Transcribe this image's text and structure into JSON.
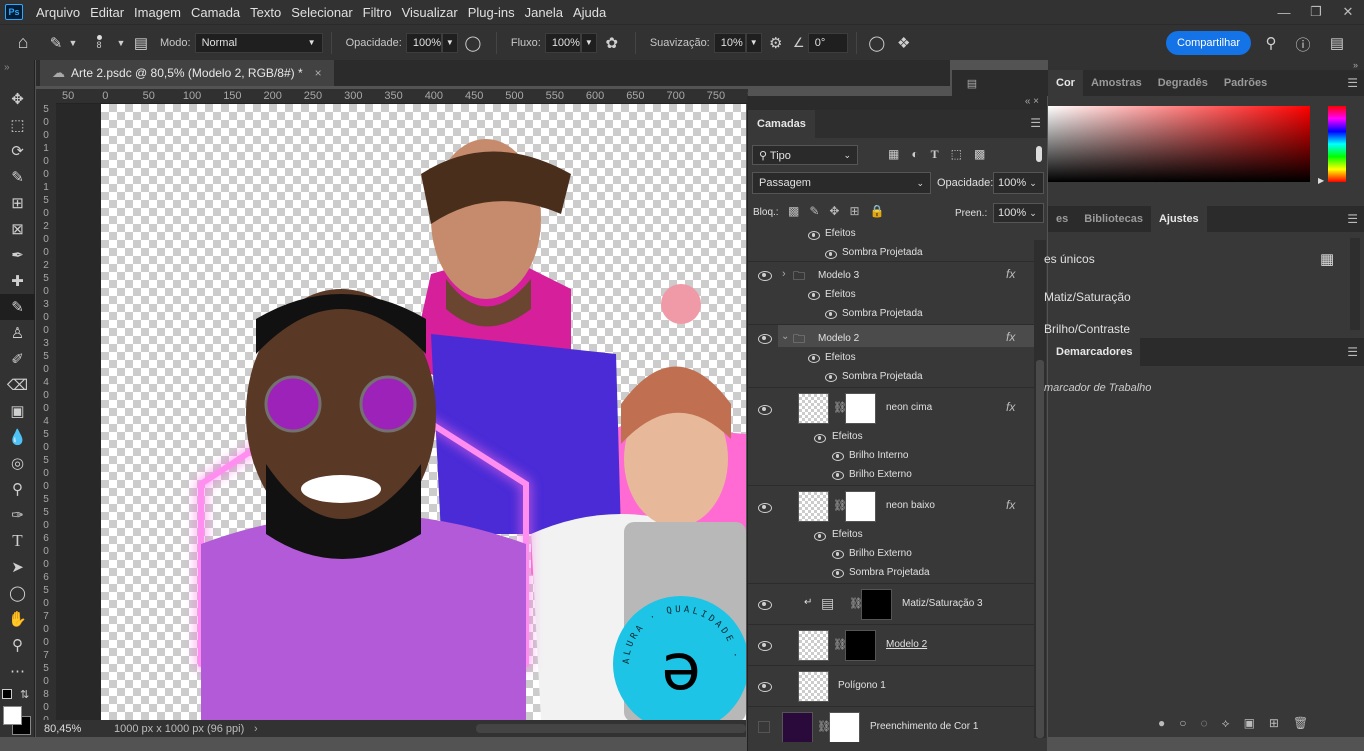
{
  "menu": [
    "Arquivo",
    "Editar",
    "Imagem",
    "Camada",
    "Texto",
    "Selecionar",
    "Filtro",
    "Visualizar",
    "Plug-ins",
    "Janela",
    "Ajuda"
  ],
  "app_logo": "Ps",
  "options": {
    "brush_size": "8",
    "mode_label": "Modo:",
    "mode_value": "Normal",
    "opacity_label": "Opacidade:",
    "opacity_value": "100%",
    "flow_label": "Fluxo:",
    "flow_value": "100%",
    "smoothing_label": "Suavização:",
    "smoothing_value": "10%",
    "angle_value": "0°",
    "share_label": "Compartilhar"
  },
  "document": {
    "tab_title": "Arte 2.psdc @ 80,5% (Modelo 2, RGB/8#) *",
    "zoom": "80,45%",
    "doc_info": "1000 px x 1000 px (96 ppi)"
  },
  "ruler_top": [
    "50",
    "0",
    "50",
    "100",
    "150",
    "200",
    "250",
    "300",
    "350",
    "400",
    "450",
    "500",
    "550",
    "600",
    "650",
    "700",
    "750",
    "800",
    "850"
  ],
  "ruler_left": [
    "5",
    "0",
    "0",
    "1",
    "0",
    "0",
    "1",
    "5",
    "0",
    "2",
    "0",
    "0",
    "2",
    "5",
    "0",
    "3",
    "0",
    "0",
    "3",
    "5",
    "0",
    "4",
    "0",
    "0",
    "4",
    "5",
    "0",
    "5",
    "0",
    "0",
    "5",
    "5",
    "0",
    "6",
    "0",
    "0",
    "6",
    "5",
    "0",
    "7",
    "0",
    "0",
    "7",
    "5",
    "0",
    "8",
    "0",
    "0",
    "8",
    "5",
    "0"
  ],
  "layers": {
    "tab": "Camadas",
    "filter_kind": "Tipo",
    "blend_mode": "Passagem",
    "opacity_label": "Opacidade:",
    "opacity_value": "100%",
    "lock_label": "Bloq.:",
    "fill_label": "Preen.:",
    "fill_value": "100%",
    "rows": {
      "r0_effects": "Efeitos",
      "r0_shadow": "Sombra Projetada",
      "modelo3": "Modelo 3",
      "m3_effects": "Efeitos",
      "m3_shadow": "Sombra Projetada",
      "modelo2": "Modelo 2",
      "m2_effects": "Efeitos",
      "m2_shadow": "Sombra Projetada",
      "neon_cima": "neon cima",
      "nc_effects": "Efeitos",
      "nc_inner": "Brilho Interno",
      "nc_outer": "Brilho Externo",
      "neon_baixo": "neon baixo",
      "nb_effects": "Efeitos",
      "nb_outer": "Brilho Externo",
      "nb_shadow": "Sombra Projetada",
      "matiz": "Matiz/Saturação 3",
      "modelo2_layer": "Modelo 2",
      "poligono": "Polígono 1",
      "preenchimento": "Preenchimento de Cor 1"
    },
    "fx": "fx"
  },
  "right": {
    "color_tabs": [
      "Cor",
      "Amostras",
      "Degradês",
      "Padrões"
    ],
    "adj_tabs": [
      "es",
      "Bibliotecas",
      "Ajustes"
    ],
    "adj_heading": "es únicos",
    "adj_items": [
      "Matiz/Saturação",
      "Brilho/Contraste"
    ],
    "paths_tab": "Demarcadores",
    "work_path": "marcador de Trabalho"
  },
  "colors": {
    "accent": "#1473e6",
    "neon_pink": "#ff6be8",
    "purple_shirt": "#b25ad8",
    "blue_shirt": "#4a2bd6",
    "alura_cyan": "#1ec4e6"
  },
  "badge_text": "ALURA · QUALIDADE · AL"
}
